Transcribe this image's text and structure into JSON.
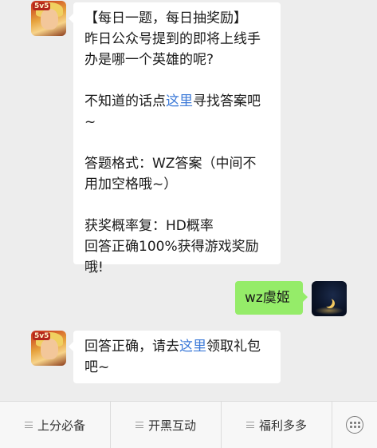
{
  "messages": [
    {
      "side": "left",
      "lines": [
        "【每日一题，每日抽奖励】",
        "昨日公众号提到的即将上线手",
        "办是哪一个英雄的呢?",
        "",
        "不知道的话点",
        "~",
        "",
        "答题格式：WZ答案（中间不",
        "用加空格哦~）",
        "",
        "获奖概率复：HD概率",
        "回答正确100%获得游戏奖励",
        "哦!"
      ],
      "link_text": "这里",
      "after_link": "寻找答案吧"
    },
    {
      "side": "right",
      "text": "wz虞姬"
    },
    {
      "side": "left",
      "before_link": "回答正确，请去",
      "link_text": "这里",
      "after_link": "领取礼包",
      "line2": "吧~"
    }
  ],
  "avatars": {
    "official_badge": "5v5"
  },
  "bottombar": {
    "items": [
      "上分必备",
      "开黑互动",
      "福利多多"
    ],
    "keyboard_icon": "keyboard-icon"
  }
}
